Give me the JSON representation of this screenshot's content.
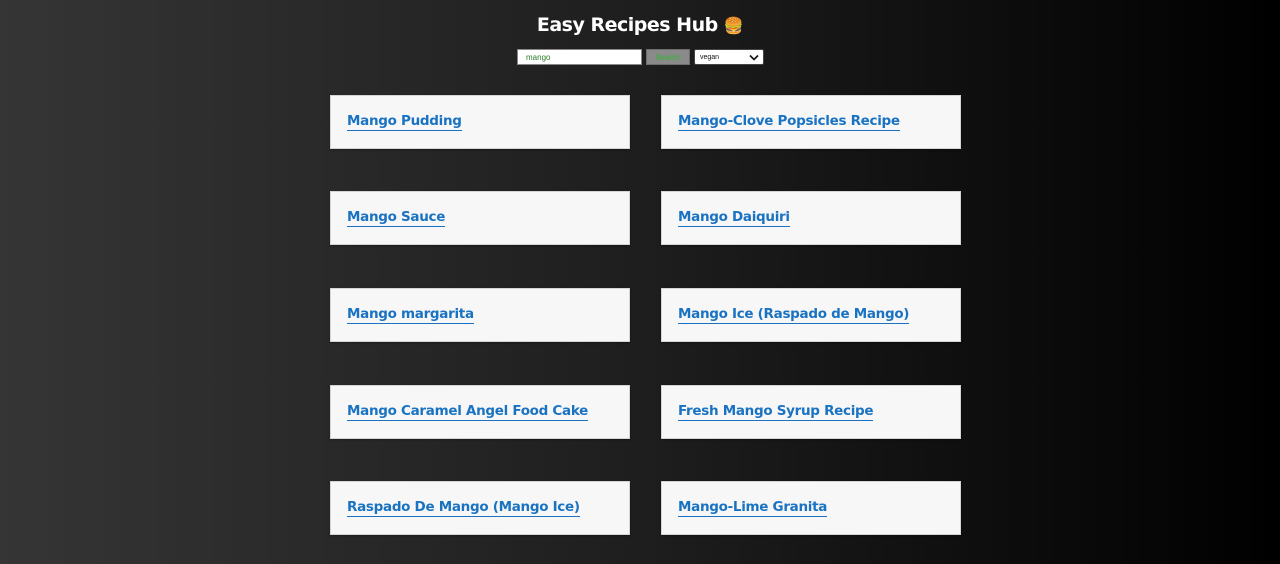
{
  "header": {
    "title": "Easy Recipes Hub",
    "emoji": "🍔"
  },
  "search": {
    "value": "mango",
    "button_label": "Search",
    "diet_selected": "vegan"
  },
  "recipes": [
    "Mango Pudding",
    "Mango-Clove Popsicles Recipe",
    "Mango Sauce",
    "Mango Daiquiri",
    "Mango margarita",
    "Mango Ice (Raspado de Mango)",
    "Mango Caramel Angel Food Cake",
    "Fresh Mango Syrup Recipe",
    "Raspado De Mango (Mango Ice)",
    "Mango-Lime Granita"
  ],
  "colors": {
    "link": "#1a73c2",
    "card_bg": "#f7f7f7",
    "search_button_text": "#2fb52f"
  },
  "icons": {
    "title_icon": "hamburger-icon",
    "select_icon": "chevron-down-icon"
  }
}
